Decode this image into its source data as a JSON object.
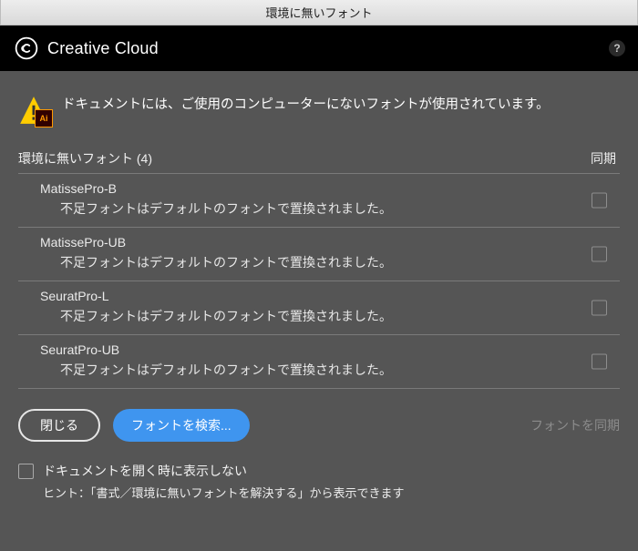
{
  "titlebar": "環境に無いフォント",
  "header": {
    "title": "Creative Cloud",
    "help_symbol": "?"
  },
  "alert": {
    "icon_badge": "Ai",
    "text": "ドキュメントには、ご使用のコンピューターにないフォントが使用されています。"
  },
  "list": {
    "heading": "環境に無いフォント (4)",
    "sync_heading": "同期"
  },
  "fonts": [
    {
      "name": "MatissePro-B",
      "message": "不足フォントはデフォルトのフォントで置換されました。"
    },
    {
      "name": "MatissePro-UB",
      "message": "不足フォントはデフォルトのフォントで置換されました。"
    },
    {
      "name": "SeuratPro-L",
      "message": "不足フォントはデフォルトのフォントで置換されました。"
    },
    {
      "name": "SeuratPro-UB",
      "message": "不足フォントはデフォルトのフォントで置換されました。"
    }
  ],
  "buttons": {
    "close": "閉じる",
    "search": "フォントを検索...",
    "sync": "フォントを同期"
  },
  "option": {
    "label": "ドキュメントを開く時に表示しない",
    "hint": "ヒント：「書式／環境に無いフォントを解決する」から表示できます"
  }
}
